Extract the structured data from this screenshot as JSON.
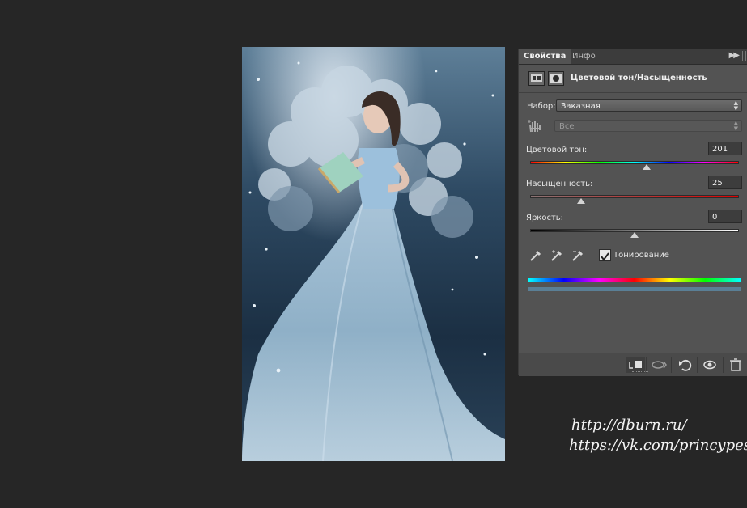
{
  "canvas": {
    "image_description_icon": "fantasy-portrait-image"
  },
  "panel": {
    "tabs": [
      {
        "label": "Свойства"
      },
      {
        "label": "Инфо"
      }
    ],
    "menu_icon": "double-chevron-icon",
    "title": "Цветовой тон/Насыщенность",
    "preset": {
      "label": "Набор:",
      "value": "Заказная"
    },
    "channel": {
      "value": "Все"
    },
    "hue": {
      "label": "Цветовой тон:",
      "value": "201",
      "fraction": 0.558
    },
    "saturation": {
      "label": "Насыщенность:",
      "value": "25",
      "fraction": 0.245
    },
    "lightness": {
      "label": "Яркость:",
      "value": "0",
      "fraction": 0.5
    },
    "colorize": {
      "label": "Тонирование",
      "checked": true
    },
    "accent_tint": "#5a7f96"
  },
  "watermark": {
    "line1": "http://dburn.ru/",
    "line2": "https://vk.com/princypessa"
  }
}
